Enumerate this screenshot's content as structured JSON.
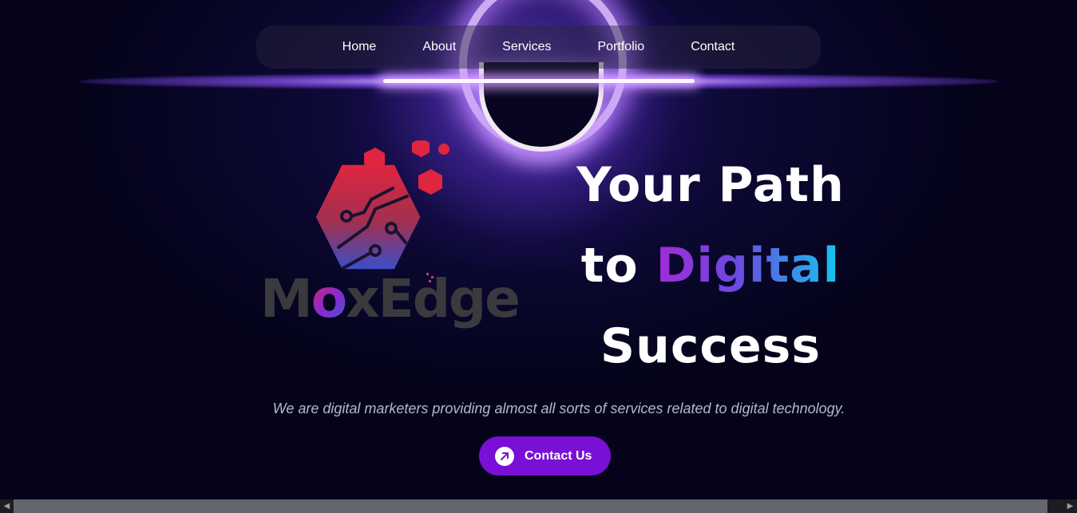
{
  "nav": {
    "items": [
      {
        "label": "Home"
      },
      {
        "label": "About"
      },
      {
        "label": "Services"
      },
      {
        "label": "Portfolio"
      },
      {
        "label": "Contact"
      }
    ]
  },
  "logo": {
    "text_prefix": "M",
    "text_accent": "o",
    "text_suffix": "xEdge"
  },
  "hero": {
    "line1": "Your Path",
    "line2_plain": "to",
    "line2_accent": "Digital",
    "line3": "Success",
    "tagline": "We are digital marketers providing almost all sorts of services related to digital technology."
  },
  "cta": {
    "label": "Contact Us",
    "icon": "arrow-up-right-icon"
  },
  "colors": {
    "background": "#05041a",
    "cta": "#7a0fd6",
    "accent_start": "#a12bd6",
    "accent_end": "#13c7f0",
    "logo_red": "#e02a4a",
    "logo_gray": "#3a3a3e"
  }
}
